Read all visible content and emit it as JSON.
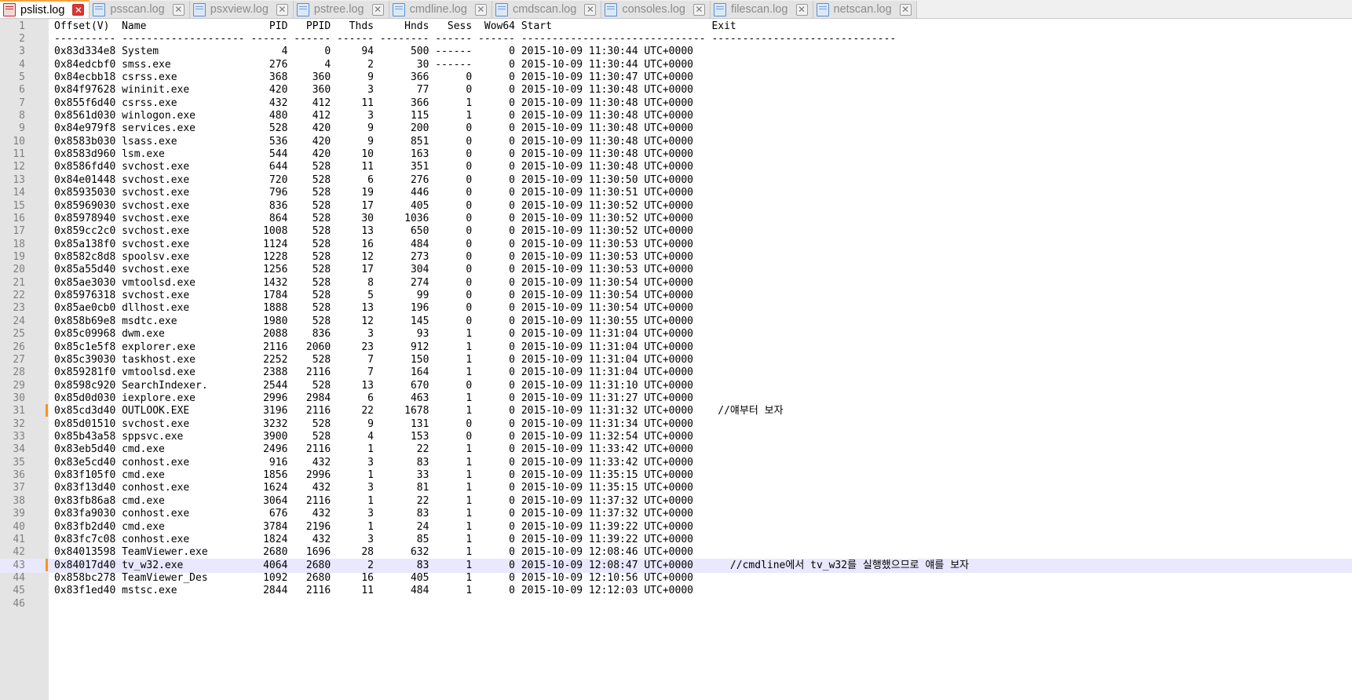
{
  "tabs": [
    {
      "label": "pslist.log",
      "active": true
    },
    {
      "label": "psscan.log",
      "active": false
    },
    {
      "label": "psxview.log",
      "active": false
    },
    {
      "label": "pstree.log",
      "active": false
    },
    {
      "label": "cmdline.log",
      "active": false
    },
    {
      "label": "cmdscan.log",
      "active": false
    },
    {
      "label": "consoles.log",
      "active": false
    },
    {
      "label": "filescan.log",
      "active": false
    },
    {
      "label": "netscan.log",
      "active": false
    }
  ],
  "editor": {
    "current_line": 43,
    "bookmarked_lines": [
      31,
      43
    ],
    "colors": {
      "gutter": "#e4e4e4",
      "current_line": "#e8e8ff",
      "bookmark": "#f7941d",
      "active_tab_accent": "#f7a23c"
    },
    "lines": [
      "Offset(V)  Name                    PID   PPID   Thds     Hnds   Sess  Wow64 Start                          Exit",
      "---------- -------------------- ------ ------ ------ -------- ------ ------ ------------------------------ ------------------------------",
      "0x83d334e8 System                    4      0     94      500 ------      0 2015-10-09 11:30:44 UTC+0000",
      "0x84edcbf0 smss.exe                276      4      2       30 ------      0 2015-10-09 11:30:44 UTC+0000",
      "0x84ecbb18 csrss.exe               368    360      9      366      0      0 2015-10-09 11:30:47 UTC+0000",
      "0x84f97628 wininit.exe             420    360      3       77      0      0 2015-10-09 11:30:48 UTC+0000",
      "0x855f6d40 csrss.exe               432    412     11      366      1      0 2015-10-09 11:30:48 UTC+0000",
      "0x8561d030 winlogon.exe            480    412      3      115      1      0 2015-10-09 11:30:48 UTC+0000",
      "0x84e979f8 services.exe            528    420      9      200      0      0 2015-10-09 11:30:48 UTC+0000",
      "0x8583b030 lsass.exe               536    420      9      851      0      0 2015-10-09 11:30:48 UTC+0000",
      "0x8583d960 lsm.exe                 544    420     10      163      0      0 2015-10-09 11:30:48 UTC+0000",
      "0x8586fd40 svchost.exe             644    528     11      351      0      0 2015-10-09 11:30:48 UTC+0000",
      "0x84e01448 svchost.exe             720    528      6      276      0      0 2015-10-09 11:30:50 UTC+0000",
      "0x85935030 svchost.exe             796    528     19      446      0      0 2015-10-09 11:30:51 UTC+0000",
      "0x85969030 svchost.exe             836    528     17      405      0      0 2015-10-09 11:30:52 UTC+0000",
      "0x85978940 svchost.exe             864    528     30     1036      0      0 2015-10-09 11:30:52 UTC+0000",
      "0x859cc2c0 svchost.exe            1008    528     13      650      0      0 2015-10-09 11:30:52 UTC+0000",
      "0x85a138f0 svchost.exe            1124    528     16      484      0      0 2015-10-09 11:30:53 UTC+0000",
      "0x8582c8d8 spoolsv.exe            1228    528     12      273      0      0 2015-10-09 11:30:53 UTC+0000",
      "0x85a55d40 svchost.exe            1256    528     17      304      0      0 2015-10-09 11:30:53 UTC+0000",
      "0x85ae3030 vmtoolsd.exe           1432    528      8      274      0      0 2015-10-09 11:30:54 UTC+0000",
      "0x85976318 svchost.exe            1784    528      5       99      0      0 2015-10-09 11:30:54 UTC+0000",
      "0x85ae0cb0 dllhost.exe            1888    528     13      196      0      0 2015-10-09 11:30:54 UTC+0000",
      "0x858b69e8 msdtc.exe              1980    528     12      145      0      0 2015-10-09 11:30:55 UTC+0000",
      "0x85c09968 dwm.exe                2088    836      3       93      1      0 2015-10-09 11:31:04 UTC+0000",
      "0x85c1e5f8 explorer.exe           2116   2060     23      912      1      0 2015-10-09 11:31:04 UTC+0000",
      "0x85c39030 taskhost.exe           2252    528      7      150      1      0 2015-10-09 11:31:04 UTC+0000",
      "0x859281f0 vmtoolsd.exe           2388   2116      7      164      1      0 2015-10-09 11:31:04 UTC+0000",
      "0x8598c920 SearchIndexer.         2544    528     13      670      0      0 2015-10-09 11:31:10 UTC+0000",
      "0x85d0d030 iexplore.exe           2996   2984      6      463      1      0 2015-10-09 11:31:27 UTC+0000",
      "0x85cd3d40 OUTLOOK.EXE            3196   2116     22     1678      1      0 2015-10-09 11:31:32 UTC+0000    //얘부터 보자",
      "0x85d01510 svchost.exe            3232    528      9      131      0      0 2015-10-09 11:31:34 UTC+0000",
      "0x85b43a58 sppsvc.exe             3900    528      4      153      0      0 2015-10-09 11:32:54 UTC+0000",
      "0x83eb5d40 cmd.exe                2496   2116      1       22      1      0 2015-10-09 11:33:42 UTC+0000",
      "0x83e5cd40 conhost.exe             916    432      3       83      1      0 2015-10-09 11:33:42 UTC+0000",
      "0x83f105f0 cmd.exe                1856   2996      1       33      1      0 2015-10-09 11:35:15 UTC+0000",
      "0x83f13d40 conhost.exe            1624    432      3       81      1      0 2015-10-09 11:35:15 UTC+0000",
      "0x83fb86a8 cmd.exe                3064   2116      1       22      1      0 2015-10-09 11:37:32 UTC+0000",
      "0x83fa9030 conhost.exe             676    432      3       83      1      0 2015-10-09 11:37:32 UTC+0000",
      "0x83fb2d40 cmd.exe                3784   2196      1       24      1      0 2015-10-09 11:39:22 UTC+0000",
      "0x83fc7c08 conhost.exe            1824    432      3       85      1      0 2015-10-09 11:39:22 UTC+0000",
      "0x84013598 TeamViewer.exe         2680   1696     28      632      1      0 2015-10-09 12:08:46 UTC+0000",
      "0x84017d40 tv_w32.exe             4064   2680      2       83      1      0 2015-10-09 12:08:47 UTC+0000      //cmdline에서 tv_w32를 실행했으므로 얘를 보자",
      "0x858bc278 TeamViewer_Des         1092   2680     16      405      1      0 2015-10-09 12:10:56 UTC+0000",
      "0x83f1ed40 mstsc.exe              2844   2116     11      484      1      0 2015-10-09 12:12:03 UTC+0000",
      ""
    ]
  }
}
